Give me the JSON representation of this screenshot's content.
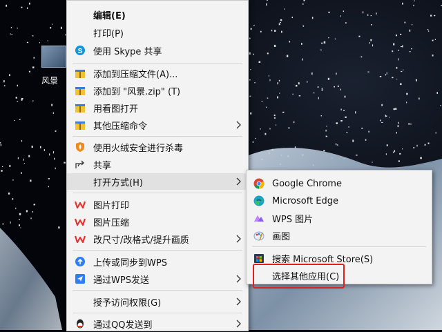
{
  "desktop": {
    "icon_label": "风景"
  },
  "context_menu": {
    "items": [
      {
        "label": "编辑(E)",
        "icon": ""
      },
      {
        "label": "打印(P)",
        "icon": ""
      },
      {
        "label": "使用 Skype 共享",
        "icon": "skype-icon"
      },
      {
        "label": "添加到压缩文件(A)...",
        "icon": "archive-icon"
      },
      {
        "label": "添加到 \"风景.zip\" (T)",
        "icon": "archive-icon"
      },
      {
        "label": "用看图打开",
        "icon": "image-viewer-icon"
      },
      {
        "label": "其他压缩命令",
        "icon": "archive-icon"
      },
      {
        "label": "使用火绒安全进行杀毒",
        "icon": "huorong-shield-icon"
      },
      {
        "label": "共享",
        "icon": "share-icon"
      },
      {
        "label": "打开方式(H)",
        "icon": ""
      },
      {
        "label": "图片打印",
        "icon": "wps-icon"
      },
      {
        "label": "图片压缩",
        "icon": "wps-icon"
      },
      {
        "label": "改尺寸/改格式/提升画质",
        "icon": "wps-icon"
      },
      {
        "label": "上传或同步到WPS",
        "icon": "cloud-upload-icon"
      },
      {
        "label": "通过WPS发送",
        "icon": "wps-send-icon"
      },
      {
        "label": "授予访问权限(G)",
        "icon": ""
      },
      {
        "label": "通过QQ发送到",
        "icon": "qq-icon"
      }
    ]
  },
  "open_with_submenu": {
    "items": [
      {
        "label": "Google Chrome",
        "icon": "chrome-icon"
      },
      {
        "label": "Microsoft Edge",
        "icon": "edge-icon"
      },
      {
        "label": "WPS 图片",
        "icon": "wps-pictures-icon"
      },
      {
        "label": "画图",
        "icon": "paint-icon"
      },
      {
        "label": "搜索 Microsoft Store(S)",
        "icon": "store-icon"
      },
      {
        "label": "选择其他应用(C)",
        "icon": ""
      }
    ]
  },
  "colors": {
    "menu_bg": "#f3f3f3",
    "highlight": "#e1e1e1",
    "annotation_red": "#e0201e"
  }
}
